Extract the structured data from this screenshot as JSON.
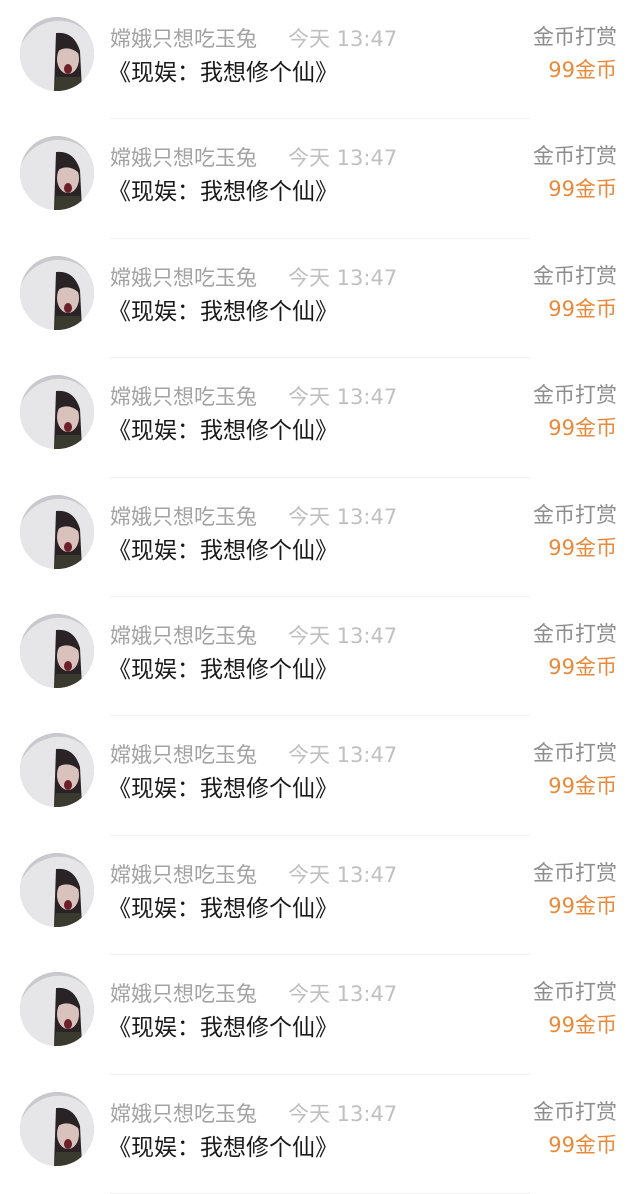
{
  "rows": [
    {
      "user": "嫦娥只想吃玉兔",
      "time": "今天 13:47",
      "book": "《现娱：我想修个仙》",
      "gift_label": "金币打赏",
      "amount": "99金币"
    },
    {
      "user": "嫦娥只想吃玉兔",
      "time": "今天 13:47",
      "book": "《现娱：我想修个仙》",
      "gift_label": "金币打赏",
      "amount": "99金币"
    },
    {
      "user": "嫦娥只想吃玉兔",
      "time": "今天 13:47",
      "book": "《现娱：我想修个仙》",
      "gift_label": "金币打赏",
      "amount": "99金币"
    },
    {
      "user": "嫦娥只想吃玉兔",
      "time": "今天 13:47",
      "book": "《现娱：我想修个仙》",
      "gift_label": "金币打赏",
      "amount": "99金币"
    },
    {
      "user": "嫦娥只想吃玉兔",
      "time": "今天 13:47",
      "book": "《现娱：我想修个仙》",
      "gift_label": "金币打赏",
      "amount": "99金币"
    },
    {
      "user": "嫦娥只想吃玉兔",
      "time": "今天 13:47",
      "book": "《现娱：我想修个仙》",
      "gift_label": "金币打赏",
      "amount": "99金币"
    },
    {
      "user": "嫦娥只想吃玉兔",
      "time": "今天 13:47",
      "book": "《现娱：我想修个仙》",
      "gift_label": "金币打赏",
      "amount": "99金币"
    },
    {
      "user": "嫦娥只想吃玉兔",
      "time": "今天 13:47",
      "book": "《现娱：我想修个仙》",
      "gift_label": "金币打赏",
      "amount": "99金币"
    },
    {
      "user": "嫦娥只想吃玉兔",
      "time": "今天 13:47",
      "book": "《现娱：我想修个仙》",
      "gift_label": "金币打赏",
      "amount": "99金币"
    },
    {
      "user": "嫦娥只想吃玉兔",
      "time": "今天 13:47",
      "book": "《现娱：我想修个仙》",
      "gift_label": "金币打赏",
      "amount": "99金币"
    }
  ],
  "colors": {
    "amount": "#e88a3a",
    "username": "#a3a3a3",
    "time": "#c0c0c0",
    "title": "#1a1a1a"
  },
  "icons": {
    "avatar": "user-avatar-photo"
  }
}
